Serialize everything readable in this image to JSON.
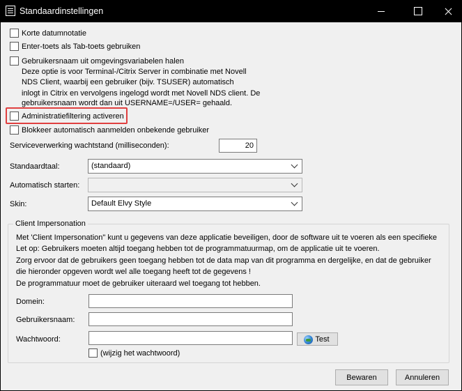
{
  "window": {
    "title": "Standaardinstellingen"
  },
  "options": {
    "korte_datum": "Korte datumnotatie",
    "enter_tab": "Enter-toets als Tab-toets gebruiken",
    "gebruikersnaam_omgeving": "Gebruikersnaam uit omgevingsvariabelen halen",
    "gebruikersnaam_desc": [
      "Deze optie is voor Terminal-/Citrix Server in combinatie met Novell",
      "NDS Client, waarbij een gebruiker (bijv. TSUSER) automatisch",
      "inlogt in Citrix en vervolgens ingelogd wordt met Novell NDS client. De",
      "gebruikersnaam wordt dan uit USERNAME=/USER= gehaald."
    ],
    "administratiefiltering": "Administratiefiltering activeren",
    "blokkeer_aanmelden": "Blokkeer automatisch aanmelden onbekende gebruiker"
  },
  "service": {
    "label": "Serviceverwerking wachtstand (milliseconden):",
    "value": "20"
  },
  "standaardtaal": {
    "label": "Standaardtaal:",
    "value": "(standaard)"
  },
  "automatisch_starten": {
    "label": "Automatisch starten:",
    "value": ""
  },
  "skin": {
    "label": "Skin:",
    "value": "Default Elvy Style"
  },
  "impersonation": {
    "title": "Client Impersonation",
    "lines": [
      "Met 'Client Impersonation\" kunt u gegevens van deze applicatie beveiligen, door de software uit te voeren als een specifieke",
      "Let op: Gebruikers moeten altijd toegang hebben tot de programmatuurmap, om de applicatie uit te voeren.",
      "Zorg ervoor dat de gebruikers geen toegang hebben tot de data map van dit programma en dergelijke, en dat de gebruiker",
      "die hieronder opgeven wordt wel alle toegang heeft tot de gegevens !",
      "De programmatuur moet de gebruiker uiteraard wel toegang tot hebben."
    ],
    "domein_label": "Domein:",
    "domein_value": "",
    "gebruikersnaam_label": "Gebruikersnaam:",
    "gebruikersnaam_value": "",
    "wachtwoord_label": "Wachtwoord:",
    "wachtwoord_value": "",
    "test_label": "Test",
    "wijzig_label": "(wijzig het wachtwoord)"
  },
  "buttons": {
    "bewaren": "Bewaren",
    "annuleren": "Annuleren"
  },
  "colors": {
    "highlight": "#e04040",
    "titlebar": "#000000"
  }
}
